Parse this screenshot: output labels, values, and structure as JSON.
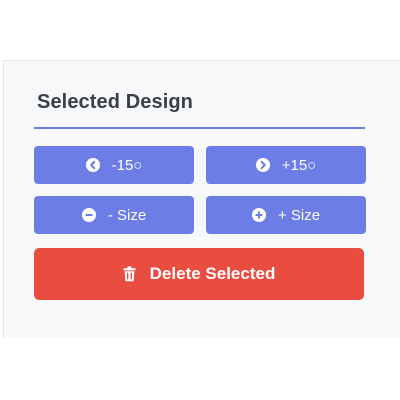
{
  "panel": {
    "title": "Selected Design"
  },
  "controls": {
    "rotate_left_label": "-15○",
    "rotate_right_label": "+15○",
    "size_down_label": "- Size",
    "size_up_label": "+ Size",
    "delete_label": "Delete Selected"
  },
  "icons": {
    "rotate_left": "chevron-left-circle-icon",
    "rotate_right": "chevron-right-circle-icon",
    "size_down": "minus-circle-icon",
    "size_up": "plus-circle-icon",
    "delete": "trash-icon"
  },
  "colors": {
    "accent": "#6c7ee6",
    "danger": "#e94d3f",
    "title_rule": "#6a7fe0",
    "panel_bg": "#f7f8fa"
  }
}
